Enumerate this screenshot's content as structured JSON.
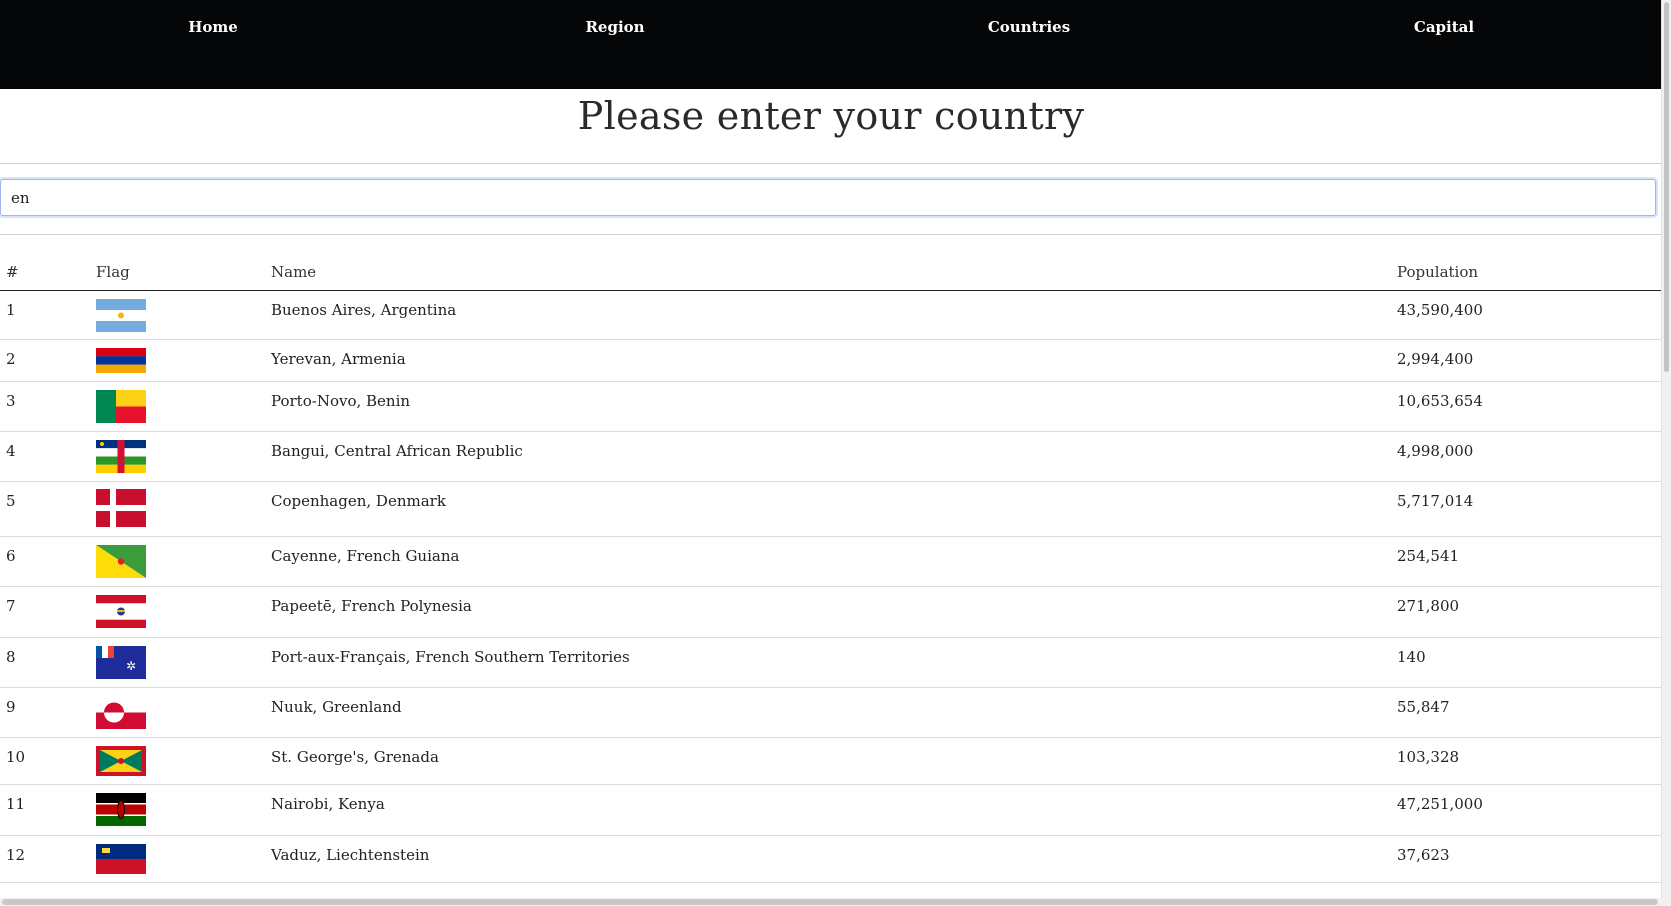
{
  "nav": {
    "items": [
      {
        "label": "Home"
      },
      {
        "label": "Region"
      },
      {
        "label": "Countries"
      },
      {
        "label": "Capital"
      }
    ]
  },
  "page": {
    "title": "Please enter your country"
  },
  "search": {
    "value": "en"
  },
  "table": {
    "headers": [
      "#",
      "Flag",
      "Name",
      "Population"
    ],
    "rows": [
      {
        "num": "1",
        "name": "Buenos Aires, Argentina",
        "population": "43,590,400",
        "flag": "argentina-flag-icon"
      },
      {
        "num": "2",
        "name": "Yerevan, Armenia",
        "population": "2,994,400",
        "flag": "armenia-flag-icon"
      },
      {
        "num": "3",
        "name": "Porto-Novo, Benin",
        "population": "10,653,654",
        "flag": "benin-flag-icon"
      },
      {
        "num": "4",
        "name": "Bangui, Central African Republic",
        "population": "4,998,000",
        "flag": "central-african-republic-flag-icon"
      },
      {
        "num": "5",
        "name": "Copenhagen, Denmark",
        "population": "5,717,014",
        "flag": "denmark-flag-icon"
      },
      {
        "num": "6",
        "name": "Cayenne, French Guiana",
        "population": "254,541",
        "flag": "french-guiana-flag-icon"
      },
      {
        "num": "7",
        "name": "Papeetē, French Polynesia",
        "population": "271,800",
        "flag": "french-polynesia-flag-icon"
      },
      {
        "num": "8",
        "name": "Port-aux-Français, French Southern Territories",
        "population": "140",
        "flag": "french-southern-territories-flag-icon"
      },
      {
        "num": "9",
        "name": "Nuuk, Greenland",
        "population": "55,847",
        "flag": "greenland-flag-icon"
      },
      {
        "num": "10",
        "name": "St. George's, Grenada",
        "population": "103,328",
        "flag": "grenada-flag-icon"
      },
      {
        "num": "11",
        "name": "Nairobi, Kenya",
        "population": "47,251,000",
        "flag": "kenya-flag-icon"
      },
      {
        "num": "12",
        "name": "Vaduz, Liechtenstein",
        "population": "37,623",
        "flag": "liechtenstein-flag-icon"
      }
    ]
  },
  "colors": {
    "nav_background": "#050608",
    "search_focus": "#9fb6ee"
  }
}
